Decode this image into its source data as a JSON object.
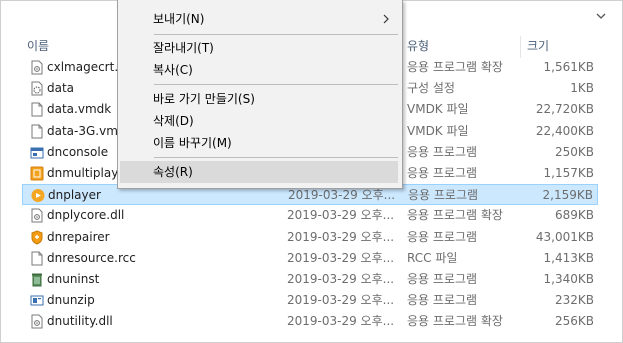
{
  "columns": {
    "name": "이름",
    "type": "유형",
    "size": "크기"
  },
  "files": [
    {
      "name": "cxlmagecrt.dll",
      "date": "",
      "type": "응용 프로그램 확장",
      "size": "1,561KB",
      "icon": "dll-file-icon"
    },
    {
      "name": "data",
      "date": "",
      "type": "구성 설정",
      "size": "1KB",
      "icon": "config-file-icon"
    },
    {
      "name": "data.vmdk",
      "date": "",
      "type": "VMDK 파일",
      "size": "22,720KB",
      "icon": "blank-file-icon"
    },
    {
      "name": "data-3G.vmdk",
      "date": "",
      "type": "VMDK 파일",
      "size": "22,400KB",
      "icon": "blank-file-icon"
    },
    {
      "name": "dnconsole",
      "date": "",
      "type": "응용 프로그램",
      "size": "250KB",
      "icon": "console-app-icon"
    },
    {
      "name": "dnmultiplayer",
      "date": "",
      "type": "응용 프로그램",
      "size": "1,157KB",
      "icon": "multiplayer-app-icon"
    },
    {
      "name": "dnplayer",
      "date": "2019-03-29 오후...",
      "type": "응용 프로그램",
      "size": "2,159KB",
      "icon": "player-app-icon"
    },
    {
      "name": "dnplycore.dll",
      "date": "2019-03-29 오후...",
      "type": "응용 프로그램 확장",
      "size": "689KB",
      "icon": "dll-file-icon"
    },
    {
      "name": "dnrepairer",
      "date": "2019-03-29 오후...",
      "type": "응용 프로그램",
      "size": "43,001KB",
      "icon": "repair-app-icon"
    },
    {
      "name": "dnresource.rcc",
      "date": "2019-03-29 오후...",
      "type": "RCC 파일",
      "size": "1,413KB",
      "icon": "blank-file-icon"
    },
    {
      "name": "dnuninst",
      "date": "2019-03-29 오후...",
      "type": "응용 프로그램",
      "size": "1,340KB",
      "icon": "uninstall-app-icon"
    },
    {
      "name": "dnunzip",
      "date": "2019-03-29 오후...",
      "type": "응용 프로그램",
      "size": "232KB",
      "icon": "unzip-app-icon"
    },
    {
      "name": "dnutility.dll",
      "date": "2019-03-29 오후...",
      "type": "응용 프로그램 확장",
      "size": "256KB",
      "icon": "dll-file-icon"
    }
  ],
  "context_menu": {
    "send_to": "보내기(N)",
    "cut": "잘라내기(T)",
    "copy": "복사(C)",
    "create_shortcut": "바로 가기 만들기(S)",
    "delete": "삭제(D)",
    "rename": "이름 바꾸기(M)",
    "properties": "속성(R)"
  },
  "selected_file": "dnplayer",
  "colors": {
    "selection_bg": "#cce8ff",
    "selection_border": "#99d1ff",
    "menu_bg": "#f2f2f2",
    "menu_highlight": "#dadada"
  }
}
